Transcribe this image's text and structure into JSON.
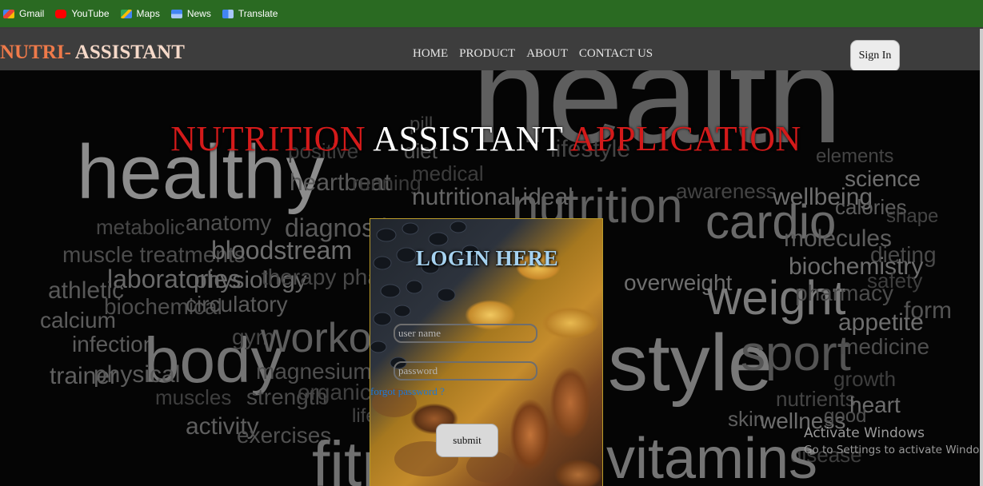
{
  "bookmarks": [
    {
      "label": "Gmail",
      "icon": "gmail-icon",
      "color": "#ea4335"
    },
    {
      "label": "YouTube",
      "icon": "youtube-icon",
      "color": "#ff0000"
    },
    {
      "label": "Maps",
      "icon": "maps-icon",
      "color": "#34a853"
    },
    {
      "label": "News",
      "icon": "news-icon",
      "color": "#4285f4"
    },
    {
      "label": "Translate",
      "icon": "translate-icon",
      "color": "#4285f4"
    }
  ],
  "navbar": {
    "brand_part1": "NUTRI-",
    "brand_part2": " ASSISTANT",
    "links": [
      "HOME",
      "PRODUCT",
      "ABOUT",
      "CONTACT US"
    ],
    "signin_label": "Sign In"
  },
  "hero": {
    "title_part1": "NUTRITION",
    "title_part2": " ASSISTANT ",
    "title_part3": "APPLICATION",
    "background_words": [
      "healthy",
      "health",
      "positive",
      "heartbeat",
      "running",
      "diet",
      "medical",
      "nutritional ideal",
      "pill",
      "metabolic",
      "anatomy",
      "diagnostic",
      "muscle treatments",
      "bloodstream",
      "physiology",
      "laboratories",
      "therapy pharmacy",
      "athletic",
      "biochemical",
      "circulatory",
      "calcium",
      "infection",
      "body",
      "gym",
      "workout",
      "trainer",
      "physical",
      "magnesium",
      "muscles",
      "strength",
      "organic",
      "activity",
      "exercises",
      "fitness",
      "life",
      "nutrition",
      "awareness",
      "cardio",
      "wellbeing",
      "calories",
      "shape",
      "science",
      "elements",
      "molecules",
      "dieting",
      "biochemistry",
      "safety",
      "overweight",
      "weight",
      "pharmacy",
      "appetite",
      "form",
      "style",
      "sport",
      "medicine",
      "growth",
      "nutrients",
      "heart",
      "skin",
      "wellness",
      "good",
      "disease",
      "vitamins",
      "lifestyle"
    ]
  },
  "login": {
    "title": "LOGIN HERE",
    "username_placeholder": "user name",
    "password_placeholder": "password",
    "forgot_label": "forgot password ?",
    "submit_label": "submit"
  },
  "watermark": {
    "line1": "Activate Windows",
    "line2": "Go to Settings to activate Windows."
  }
}
